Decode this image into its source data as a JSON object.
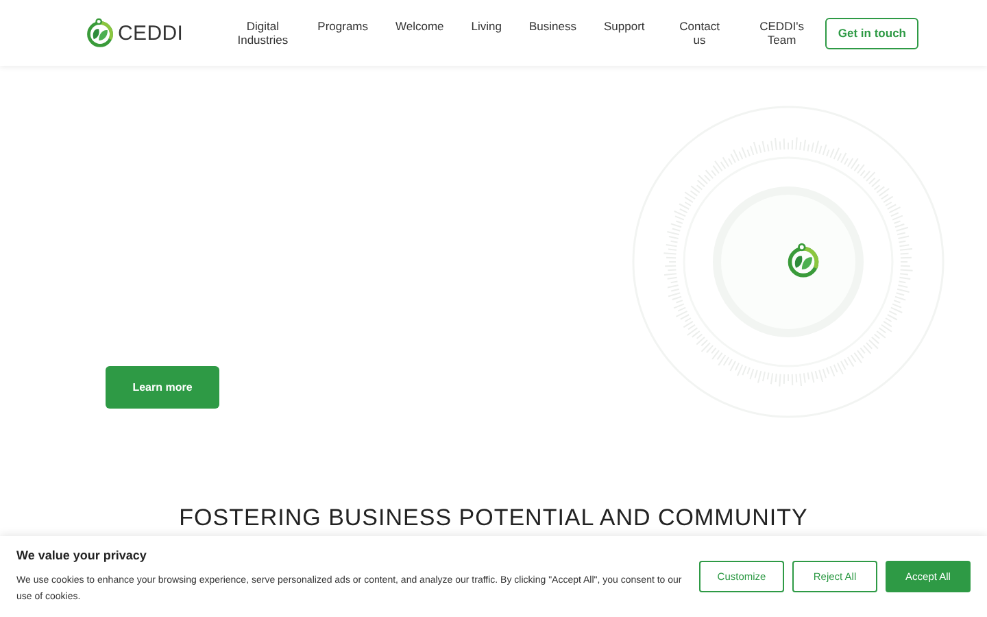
{
  "header": {
    "logo_text": "CEDDI",
    "nav": [
      {
        "label": "Digital Industries"
      },
      {
        "label": "Programs"
      },
      {
        "label": "Welcome"
      },
      {
        "label": "Living"
      },
      {
        "label": "Business"
      },
      {
        "label": "Support"
      },
      {
        "label": "Contact us"
      },
      {
        "label": "CEDDI's Team"
      }
    ],
    "cta": "Get in touch"
  },
  "hero": {
    "button": "Learn more"
  },
  "section_heading": "FOSTERING BUSINESS POTENTIAL AND COMMUNITY",
  "cookie_banner": {
    "title": "We value your privacy",
    "text": "We use cookies to enhance your browsing experience, serve personalized ads or content, and analyze our traffic. By clicking \"Accept All\", you consent to our use of cookies.",
    "buttons": [
      {
        "label": "Customize",
        "kind": "outline"
      },
      {
        "label": "Reject All",
        "kind": "outline"
      },
      {
        "label": "Accept All",
        "kind": "filled"
      }
    ]
  }
}
